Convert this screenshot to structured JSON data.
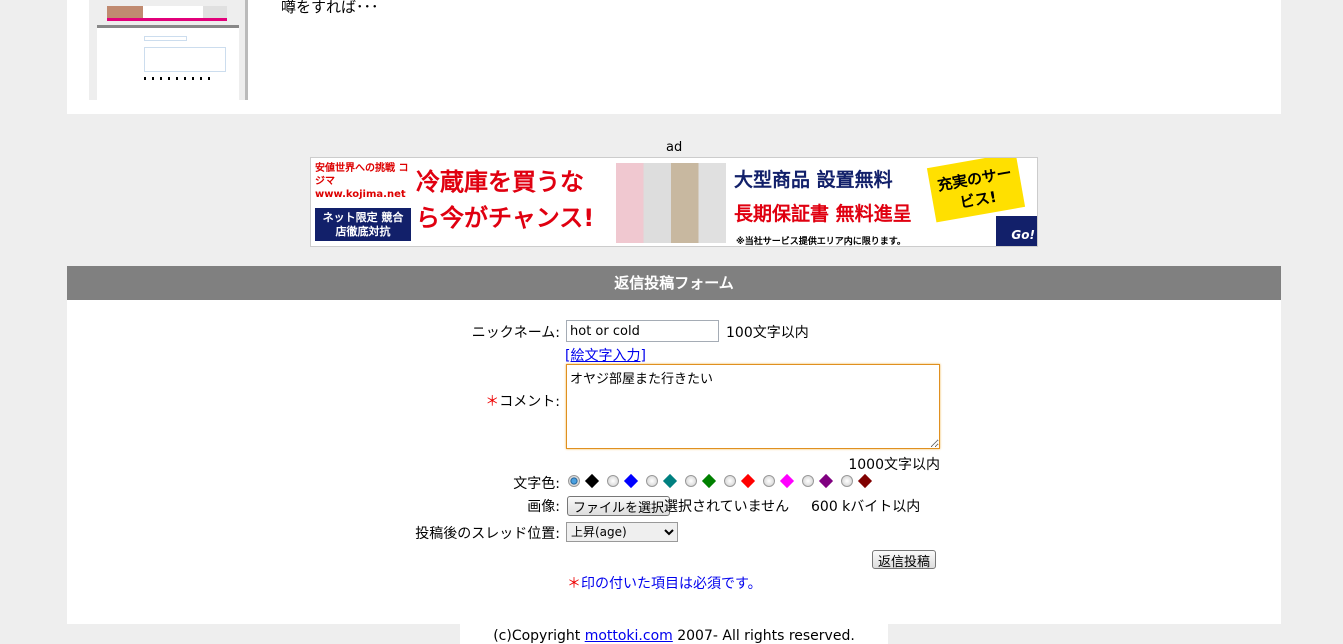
{
  "thread": {
    "preview_text": "噂をすれば･･･"
  },
  "ad": {
    "label": "ad",
    "banner_text": [
      "安値世界への挑戦 コジマ www.kojima.net",
      "ネット限定 競合店徹底対抗",
      "冷蔵庫を買うなら今がチャンス!",
      "大型商品 設置無料",
      "長期保証書 無料進呈",
      "充実のサービス!",
      "※当社サービス提供エリア内に限ります。",
      "Go!"
    ]
  },
  "form": {
    "title": "返信投稿フォーム",
    "nickname_label": "ニックネーム:",
    "nickname_value": "hot or cold",
    "nickname_limit": "100文字以内",
    "emoji_link": "[絵文字入力]",
    "required_mark": "＊",
    "comment_label": "コメント:",
    "comment_value": "オヤジ部屋また行きたい",
    "comment_limit": "1000文字以内",
    "color_label": "文字色:",
    "colors": [
      "#000000",
      "#0000ff",
      "#008080",
      "#008000",
      "#ff0000",
      "#ff00ff",
      "#800080",
      "#800000"
    ],
    "selected_color": "#000000",
    "image_label": "画像:",
    "file_button": "ファイルを選択",
    "file_status": "選択されていません",
    "image_limit": "600 kバイト以内",
    "position_label": "投稿後のスレッド位置:",
    "position_value": "上昇(age)",
    "submit": "返信投稿",
    "note": "印の付いた項目は必須です。"
  },
  "footer": {
    "prefix": "(c)Copyright ",
    "link": "mottoki.com",
    "suffix": " 2007- All rights reserved."
  }
}
